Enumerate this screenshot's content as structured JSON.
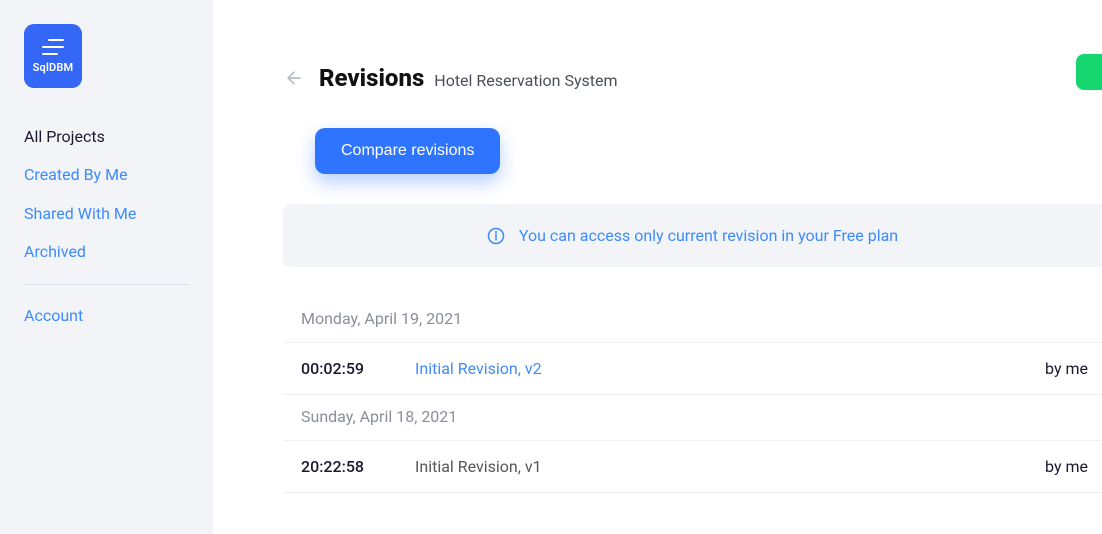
{
  "brand": {
    "name": "SqlDBM"
  },
  "sidebar": {
    "items": [
      {
        "label": "All Projects",
        "active": true
      },
      {
        "label": "Created By Me",
        "active": false
      },
      {
        "label": "Shared With Me",
        "active": false
      },
      {
        "label": "Archived",
        "active": false
      }
    ],
    "account_label": "Account"
  },
  "header": {
    "title": "Revisions",
    "subtitle": "Hotel Reservation System"
  },
  "actions": {
    "compare_label": "Compare revisions"
  },
  "notice": {
    "text": "You can access only current revision in your Free plan"
  },
  "revisions": {
    "groups": [
      {
        "date": "Monday, April 19, 2021",
        "items": [
          {
            "time": "00:02:59",
            "name": "Initial Revision, v2",
            "by": "by me",
            "current": true
          }
        ]
      },
      {
        "date": "Sunday, April 18, 2021",
        "items": [
          {
            "time": "20:22:58",
            "name": "Initial Revision, v1",
            "by": "by me",
            "current": false
          }
        ]
      }
    ]
  },
  "colors": {
    "accent": "#2f74ff",
    "link": "#3d8bfd",
    "success": "#16d66f",
    "sidebar_bg": "#f2f4f7"
  }
}
